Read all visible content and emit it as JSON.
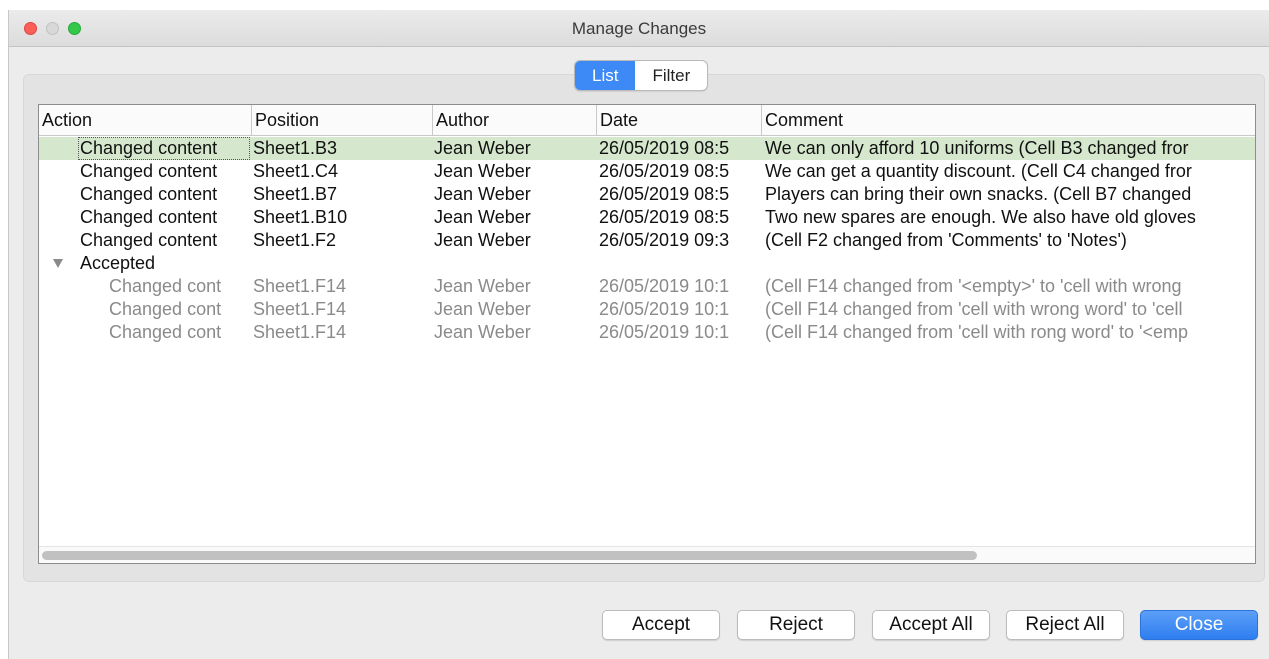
{
  "window": {
    "title": "Manage Changes"
  },
  "tabs": [
    {
      "label": "List",
      "active": true
    },
    {
      "label": "Filter",
      "active": false
    }
  ],
  "columns": [
    "Action",
    "Position",
    "Author",
    "Date",
    "Comment"
  ],
  "rows": [
    {
      "action": "Changed content",
      "position": "Sheet1.B3",
      "author": "Jean Weber",
      "date": "26/05/2019 08:5",
      "comment": "We can only afford 10 uniforms (Cell B3 changed fror"
    },
    {
      "action": "Changed content",
      "position": "Sheet1.C4",
      "author": "Jean Weber",
      "date": "26/05/2019 08:5",
      "comment": "We can get a quantity discount. (Cell C4 changed fror"
    },
    {
      "action": "Changed content",
      "position": "Sheet1.B7",
      "author": "Jean Weber",
      "date": "26/05/2019 08:5",
      "comment": "Players can bring their own snacks. (Cell B7 changed"
    },
    {
      "action": "Changed content",
      "position": "Sheet1.B10",
      "author": "Jean Weber",
      "date": "26/05/2019 08:5",
      "comment": "Two new spares are enough. We also have old gloves"
    },
    {
      "action": "Changed content",
      "position": "Sheet1.F2",
      "author": "Jean Weber",
      "date": "26/05/2019 09:3",
      "comment": " (Cell F2 changed from 'Comments' to 'Notes')"
    }
  ],
  "accepted": {
    "label": "Accepted",
    "rows": [
      {
        "action": "Changed cont",
        "position": "Sheet1.F14",
        "author": "Jean Weber",
        "date": "26/05/2019 10:1",
        "comment": " (Cell F14 changed from '<empty>' to 'cell with wrong"
      },
      {
        "action": "Changed cont",
        "position": "Sheet1.F14",
        "author": "Jean Weber",
        "date": "26/05/2019 10:1",
        "comment": " (Cell F14 changed from 'cell with wrong word' to 'cell"
      },
      {
        "action": "Changed cont",
        "position": "Sheet1.F14",
        "author": "Jean Weber",
        "date": "26/05/2019 10:1",
        "comment": " (Cell F14 changed from 'cell with rong word' to '<emp"
      }
    ]
  },
  "buttons": {
    "accept": "Accept",
    "reject": "Reject",
    "accept_all": "Accept All",
    "reject_all": "Reject All",
    "close": "Close"
  },
  "colors": {
    "selection": "#d5e8cd",
    "accent": "#3d89f5"
  }
}
